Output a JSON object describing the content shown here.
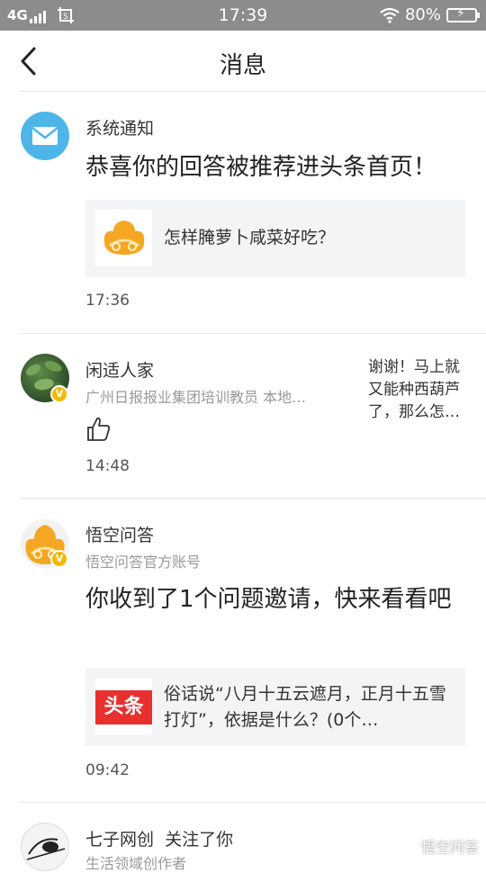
{
  "status_bar": {
    "network": "4G",
    "time": "17:39",
    "battery": "80%"
  },
  "header": {
    "title": "消息"
  },
  "messages": [
    {
      "sender": "系统通知",
      "content": "恭喜你的回答被推荐进头条首页！",
      "card_text": "怎样腌萝卜咸菜好吃？",
      "time": "17:36"
    },
    {
      "sender": "闲适人家",
      "subtitle": "广州日报报业集团培训教员 本地…",
      "quote": "谢谢！马上就又能种西葫芦了，那么怎…",
      "time": "14:48"
    },
    {
      "sender": "悟空问答",
      "subtitle": "悟空问答官方账号",
      "content": "你收到了1个问题邀请，快来看看吧",
      "card_thumb_label": "头条",
      "card_text": "俗话说“八月十五云遮月，正月十五雪打灯”，依据是什么？(0个…",
      "time": "09:42"
    },
    {
      "sender": "七子网创",
      "action": "关注了你",
      "subtitle": "生活领域创作者"
    }
  ],
  "watermark": "悟空问答",
  "colors": {
    "status_bar": "#8c8c8c",
    "system_icon": "#4db5e8",
    "card_bg": "#f3f4f6",
    "toutiao_red": "#e8302f",
    "verified_badge": "#f5b800"
  }
}
